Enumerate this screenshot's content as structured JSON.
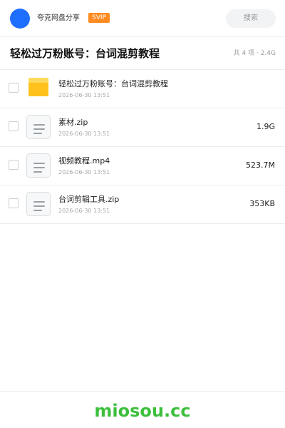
{
  "header": {
    "share_name": "夸克网盘分享",
    "badge": "SVIP",
    "search_placeholder": "搜索",
    "avatar_color": "#1f6fff",
    "badge_color": "#ff8a1f"
  },
  "share": {
    "title": "轻松过万粉账号：台词混剪教程",
    "summary": "共 4 项 · 2.4G"
  },
  "files": [
    {
      "icon": "folder-icon",
      "name": "轻松过万粉账号：台词混剪教程",
      "date": "2026-06-30 13:51",
      "size": ""
    },
    {
      "icon": "file-icon",
      "name": "素材.zip",
      "date": "2026-06-30 13:51",
      "size": "1.9G"
    },
    {
      "icon": "file-icon",
      "name": "视频教程.mp4",
      "date": "2026-06-30 13:51",
      "size": "523.7M"
    },
    {
      "icon": "file-icon",
      "name": "台词剪辑工具.zip",
      "date": "2026-06-30 13:51",
      "size": "353KB"
    }
  ],
  "footer": {
    "brand": "miosou.cc",
    "brand_color": "#3cbf3c"
  }
}
